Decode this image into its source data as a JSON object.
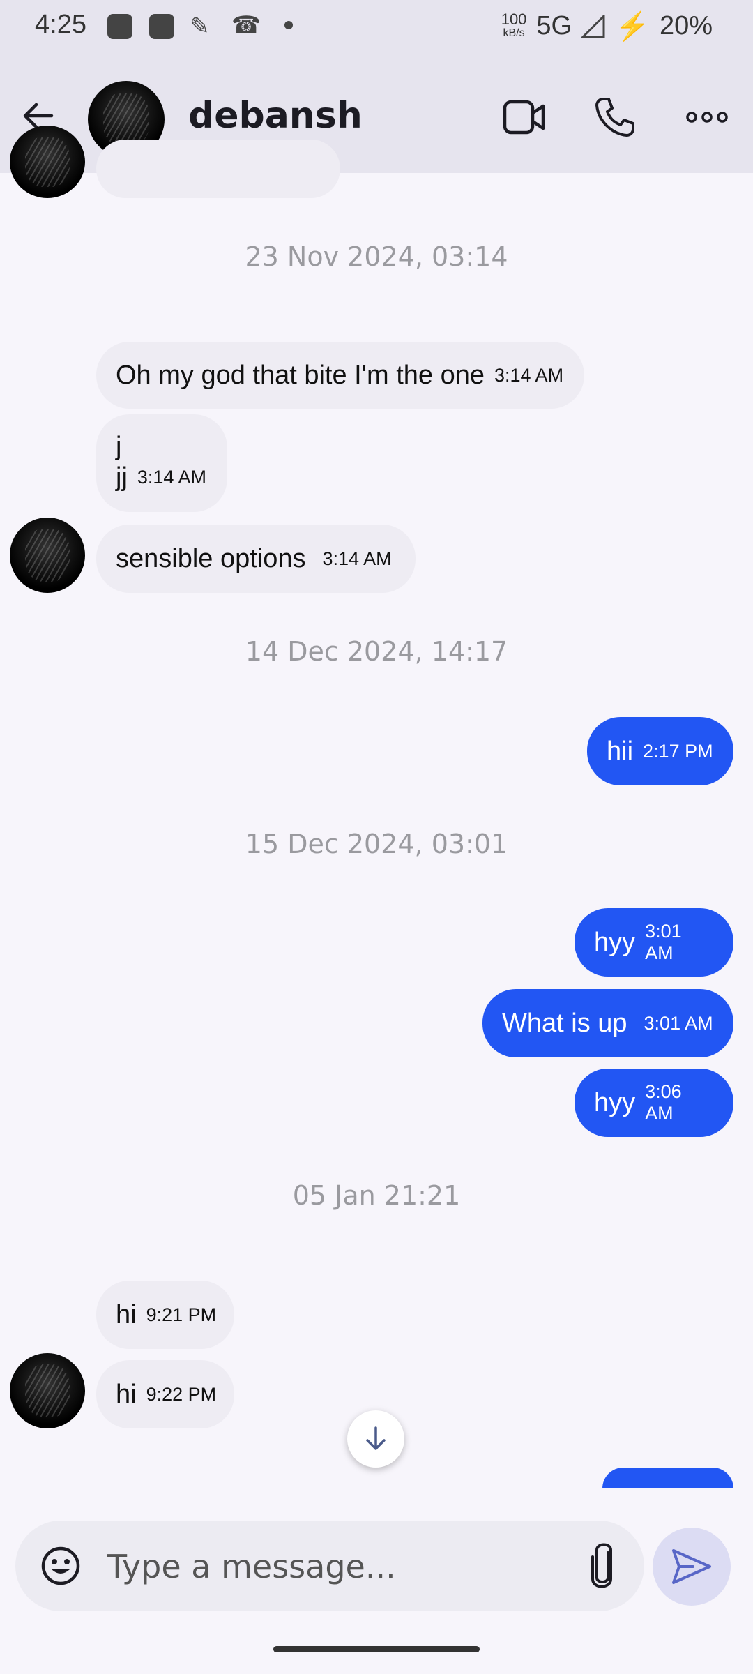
{
  "status_bar": {
    "time": "4:25",
    "speed_value": "100",
    "speed_unit": "kB/s",
    "network": "5G",
    "battery": "20%"
  },
  "header": {
    "contact_name": "debansh",
    "icons": [
      "back-arrow-icon",
      "video-call-icon",
      "phone-icon",
      "more-options-icon"
    ]
  },
  "messages": {
    "date_1": "23 Nov 2024, 03:14",
    "in_1_text": "Oh my god that bite I'm the one",
    "in_1_time": "3:14 AM",
    "in_2_line1": "j",
    "in_2_line2": "jj",
    "in_2_time": "3:14 AM",
    "in_3_text": "sensible options",
    "in_3_time": "3:14 AM",
    "date_2": "14 Dec 2024, 14:17",
    "out_1_text": "hii",
    "out_1_time": "2:17 PM",
    "date_3": "15 Dec 2024, 03:01",
    "out_2_text": "hyy",
    "out_2_time": "3:01 AM",
    "out_3_text": "What is up",
    "out_3_time": "3:01 AM",
    "out_4_text": "hyy",
    "out_4_time": "3:06 AM",
    "date_4": "05 Jan 21:21",
    "in_4_text": "hi",
    "in_4_time": "9:21 PM",
    "in_5_text": "hi",
    "in_5_time": "9:22 PM"
  },
  "composer": {
    "placeholder": "Type a message..."
  },
  "colors": {
    "outgoing_bubble": "#2256f3",
    "incoming_bubble": "#eeecf3",
    "header_bg": "#e6e4ee"
  }
}
